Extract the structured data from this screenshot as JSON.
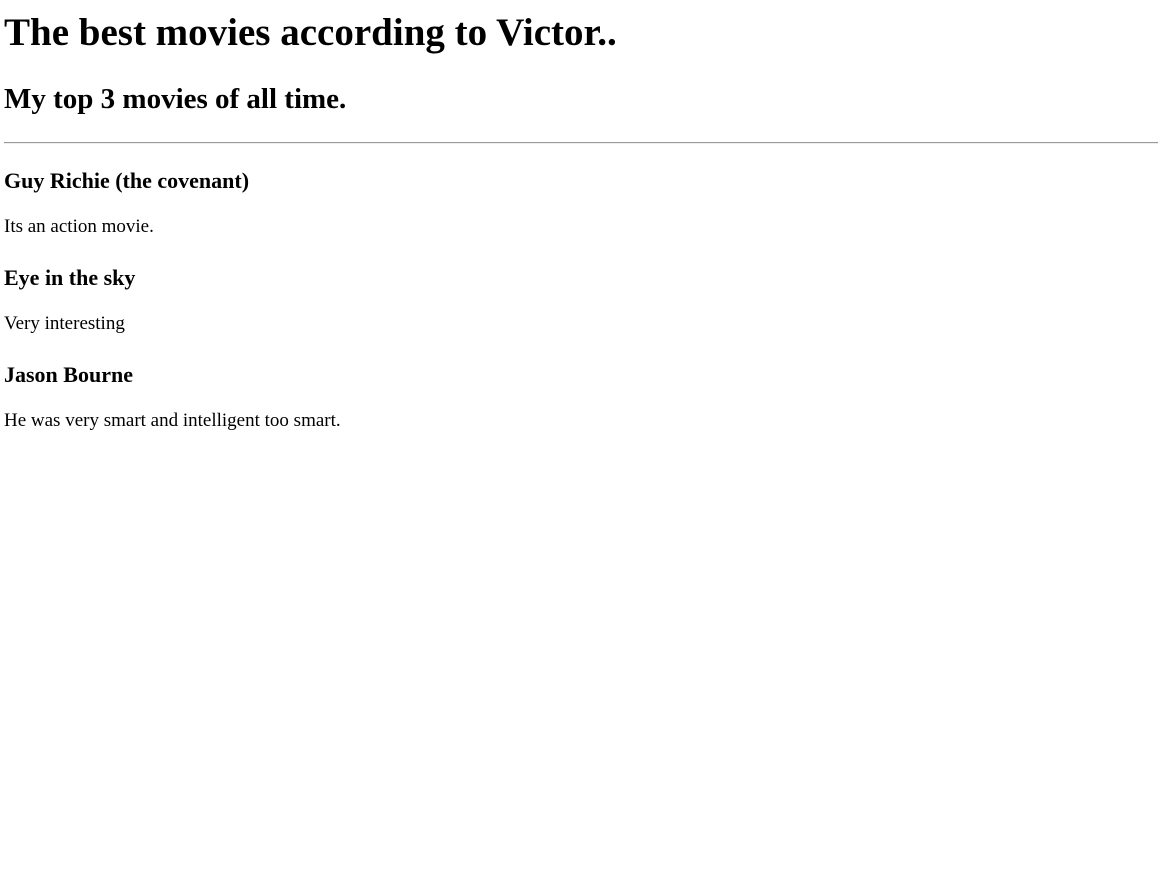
{
  "page": {
    "title": "The best movies according to Victor..",
    "subtitle": "My top 3 movies of all time."
  },
  "movies": [
    {
      "title": "Guy Richie (the covenant)",
      "description": "Its an action movie."
    },
    {
      "title": "Eye in the sky",
      "description": "Very interesting"
    },
    {
      "title": "Jason Bourne",
      "description": "He was very smart and intelligent too smart."
    }
  ]
}
